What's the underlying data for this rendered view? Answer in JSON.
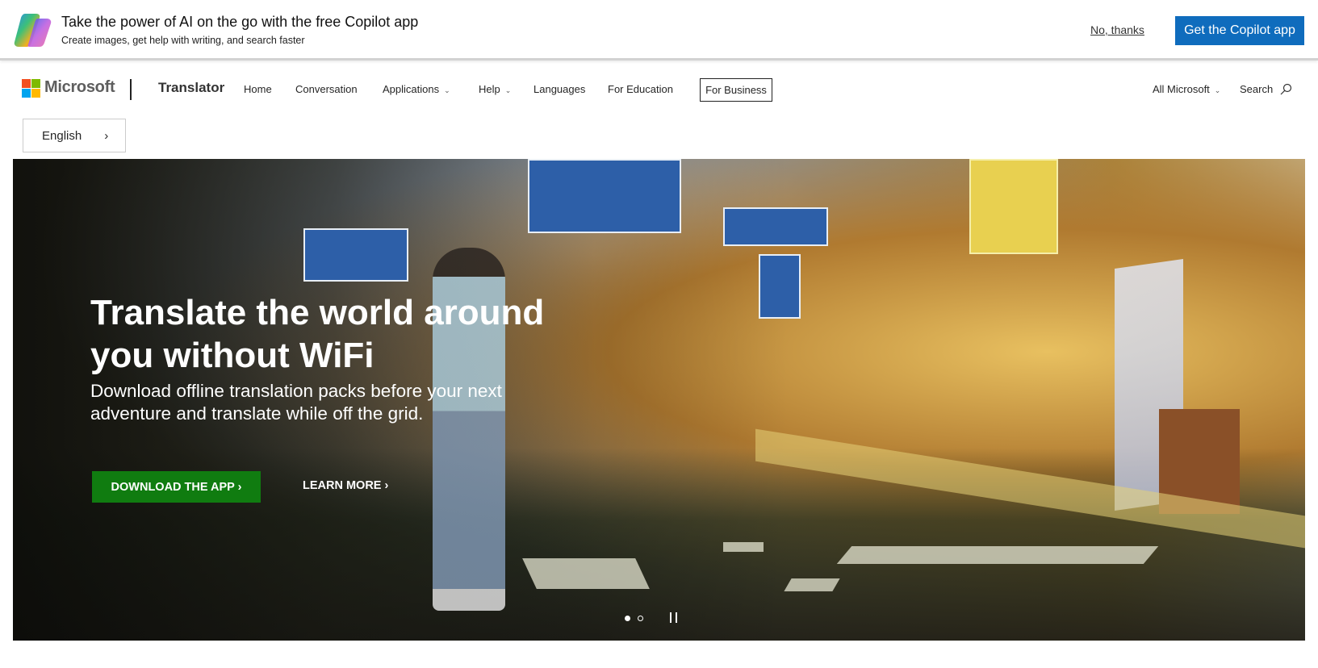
{
  "banner": {
    "title": "Take the power of AI on the go with the free Copilot app",
    "subtitle": "Create images, get help with writing, and search faster",
    "dismiss": "No, thanks",
    "cta": "Get the Copilot app",
    "cta_color": "#0f6cbd"
  },
  "nav": {
    "brand": "Microsoft",
    "product": "Translator",
    "items": [
      {
        "label": "Home"
      },
      {
        "label": "Conversation"
      },
      {
        "label": "Applications",
        "dropdown": true
      },
      {
        "label": "Help",
        "dropdown": true
      },
      {
        "label": "Languages"
      },
      {
        "label": "For Education"
      }
    ],
    "for_business": "For Business",
    "all_microsoft": "All Microsoft",
    "search": "Search"
  },
  "language": {
    "selected": "English"
  },
  "hero": {
    "headline": "Translate the world around you without WiFi",
    "body": "Download offline translation packs before your next adventure and translate while off the grid.",
    "primary_cta": "DOWNLOAD THE APP ›",
    "secondary_cta": "LEARN MORE ›",
    "primary_color": "#107c10",
    "slides": 2,
    "active_slide": 1
  }
}
